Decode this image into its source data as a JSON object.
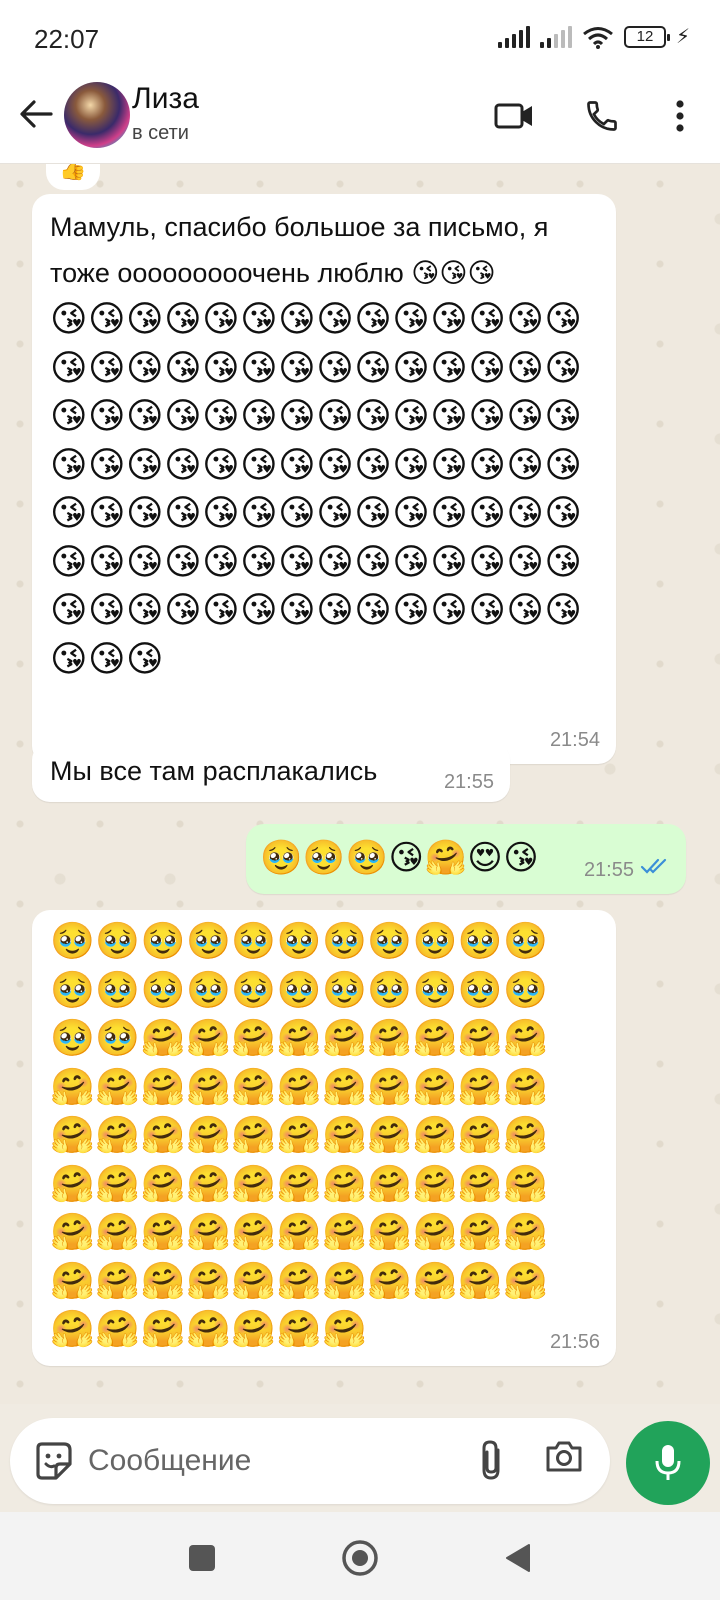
{
  "status_bar": {
    "time": "22:07",
    "battery": "12"
  },
  "header": {
    "contact_name": "Лиза",
    "contact_status": "в сети"
  },
  "messages": [
    {
      "direction": "incoming",
      "text": "Мамуль, спасибо большое за письмо, я тоже ооооооооочень люблю 😘😘😘",
      "emojis": "😘😘😘😘😘😘😘😘😘😘😘😘😘😘😘😘😘😘😘😘😘😘😘😘😘😘😘😘😘😘😘😘😘😘😘😘😘😘😘😘😘😘😘😘😘😘😘😘😘😘😘😘😘😘😘😘😘😘😘😘😘😘😘😘😘😘😘😘😘😘😘😘😘😘😘😘😘😘😘😘😘😘😘😘😘😘😘😘😘😘😘😘😘😘😘😘😘😘😘😘😘",
      "time": "21:54"
    },
    {
      "direction": "incoming",
      "text": "Мы все там расплакались",
      "time": "21:55"
    },
    {
      "direction": "outgoing",
      "emojis": "🥹🥹🥹😘🤗😍😘",
      "time": "21:55",
      "status": "read"
    },
    {
      "direction": "incoming",
      "emojis": "🥹🥹🥹🥹🥹🥹🥹🥹🥹🥹🥹🥹🥹🥹🥹🥹🥹🥹🥹🥹🥹🥹🥹🥹🤗🤗🤗🤗🤗🤗🤗🤗🤗🤗🤗🤗🤗🤗🤗🤗🤗🤗🤗🤗🤗🤗🤗🤗🤗🤗🤗🤗🤗🤗🤗🤗🤗🤗🤗🤗🤗🤗🤗🤗🤗🤗🤗🤗🤗🤗🤗🤗🤗🤗🤗🤗🤗🤗🤗🤗🤗🤗🤗🤗🤗🤗🤗🤗🤗🤗🤗🤗🤗🤗🤗",
      "time": "21:56"
    }
  ],
  "composer": {
    "placeholder": "Сообщение"
  },
  "icons": {
    "back": "arrow-left-icon",
    "video": "video-camera-icon",
    "call": "phone-icon",
    "more": "more-vertical-icon",
    "sticker": "sticker-icon",
    "attach": "paperclip-icon",
    "camera": "camera-icon",
    "mic": "microphone-icon"
  },
  "colors": {
    "outgoing_bubble": "#d9fdd3",
    "mic_button": "#21a35a",
    "read_ticks": "#3b8fd8"
  }
}
